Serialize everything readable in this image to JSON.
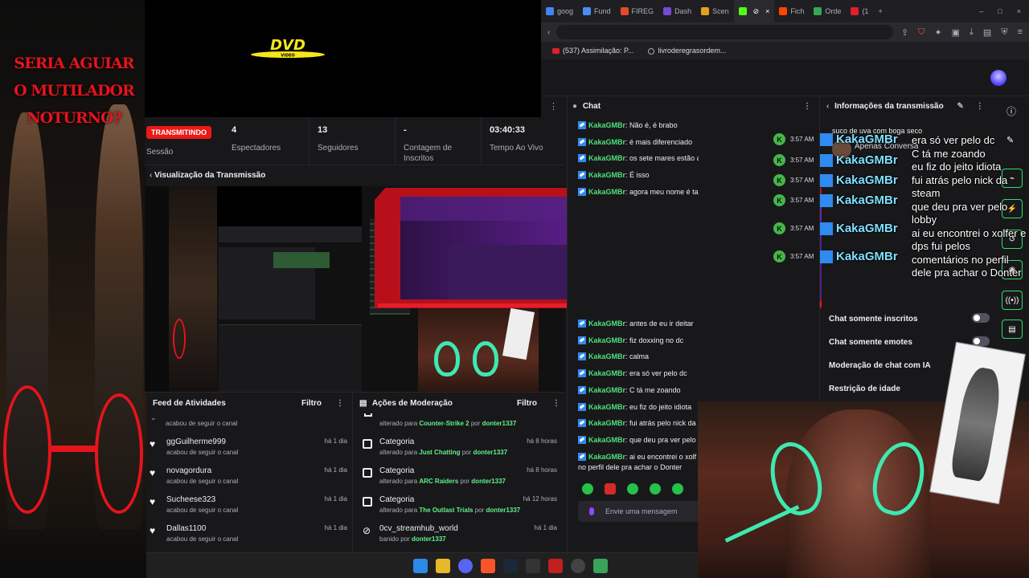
{
  "browser": {
    "tabs": [
      {
        "label": "goog",
        "color": "#4285f4"
      },
      {
        "label": "Fund",
        "color": "#4c8bf5"
      },
      {
        "label": "FIREG",
        "color": "#e24a2a"
      },
      {
        "label": "Dash",
        "color": "#7a4bd0"
      },
      {
        "label": "Scen",
        "color": "#e6a020"
      },
      {
        "label": "",
        "color": "#53fc18"
      },
      {
        "label": "Fich",
        "color": "#ff4500"
      },
      {
        "label": "Orde",
        "color": "#34a853"
      },
      {
        "label": "(1",
        "color": "#e0202a"
      }
    ],
    "new_tab": "+",
    "bookmarks": [
      "(537) Assimilação: P...",
      "livroderegrasordem..."
    ]
  },
  "overlay": {
    "title": "SERIA AGUIAR O MUTILADOR NOTURNO?",
    "dvd_text": "DVD",
    "dvd_sub": "VIDEO"
  },
  "stats": {
    "live_badge": "TRANSMITINDO",
    "session_label": "Sessão",
    "viewers_value": "4",
    "viewers_label": "Espectadores",
    "followers_value": "13",
    "followers_label": "Seguidores",
    "subs_value": "-",
    "subs_label": "Contagem de Inscritos",
    "uptime_value": "03:40:33",
    "uptime_label": "Tempo Ao Vivo"
  },
  "preview": {
    "title": "Visualização da Transmissão"
  },
  "chat": {
    "title": "Chat",
    "messages": [
      {
        "user": "KakaGMBr",
        "text": "Não é, é brabo"
      },
      {
        "user": "KakaGMBr",
        "text": "é mais diferenciado"
      },
      {
        "user": "KakaGMBr",
        "text": "os sete mares estão ai pra isso pô"
      },
      {
        "user": "KakaGMBr",
        "text": "É isso"
      },
      {
        "user": "KakaGMBr",
        "text": "agora meu nome é tachas"
      }
    ],
    "messages_lower": [
      {
        "user": "KakaGMBr",
        "text": "antes de eu ir deitar"
      },
      {
        "user": "KakaGMBr",
        "text": "fiz doxxing no dc"
      },
      {
        "user": "KakaGMBr",
        "text": "calma"
      },
      {
        "user": "KakaGMBr",
        "text": "era só ver pelo dc"
      },
      {
        "user": "KakaGMBr",
        "text": "C tá me zoando"
      },
      {
        "user": "KakaGMBr",
        "text": "eu fiz do jeito idiota"
      },
      {
        "user": "KakaGMBr",
        "text": "fui atrás pelo nick da"
      },
      {
        "user": "KakaGMBr",
        "text": "que deu pra ver pelo"
      },
      {
        "user": "KakaGMBr",
        "text": "ai eu encontrei o xolf"
      }
    ],
    "wrap_line": "no perfil dele pra achar o Donter",
    "input_placeholder": "Envie uma mensagem"
  },
  "times": [
    "3:57 AM",
    "3:57 AM",
    "3:57 AM",
    "3:57 AM",
    "3:57 AM",
    "3:57 AM"
  ],
  "overlay_chat": {
    "names": [
      "KakaGMBr",
      "KakaGMBr",
      "KakaGMBr",
      "KakaGMBr",
      "KakaGMBr",
      "KakaGMBr"
    ],
    "message_lines": [
      "era só ver pelo dc",
      "C tá me zoando",
      "eu fiz do jeito idiota",
      "fui atrás pelo nick da steam",
      "que deu pra ver pelo lobby",
      "ai eu encontrei o xolfer e dps fui pelos comentários no perfil dele pra achar o Donter"
    ]
  },
  "info": {
    "title": "Informações da transmissão",
    "stream_title": "suco de uva com boga seco",
    "mini_chat_text": "Apenas Conversa",
    "toggles": [
      {
        "label": "Chat somente inscritos",
        "on": false
      },
      {
        "label": "Chat somente emotes",
        "on": false
      },
      {
        "label": "Moderação de chat com IA"
      },
      {
        "label": "Restrição de idade"
      }
    ]
  },
  "feed": {
    "title": "Feed de Atividades",
    "filter": "Filtro",
    "first_sub": "acabou de seguir o canal",
    "items": [
      {
        "name": "ggGuilherme999",
        "sub": "acabou de seguir o canal",
        "time": "há 1 dia"
      },
      {
        "name": "novagordura",
        "sub": "acabou de seguir o canal",
        "time": "há 1 dia"
      },
      {
        "name": "Sucheese323",
        "sub": "acabou de seguir o canal",
        "time": "há 1 dia"
      },
      {
        "name": "Dallas1100",
        "sub": "acabou de seguir o canal",
        "time": "há 1 dia"
      }
    ]
  },
  "moderation": {
    "title": "Ações de Moderação",
    "filter": "Filtro",
    "first": {
      "prefix": "alterado para ",
      "game": "Counter-Strike 2",
      "by": " por ",
      "user": "donter1337"
    },
    "items": [
      {
        "name": "Categoria",
        "prefix": "alterado para ",
        "value": "Just Chatting",
        "by": " por ",
        "user": "donter1337",
        "time": "há 8 horas"
      },
      {
        "name": "Categoria",
        "prefix": "alterado para ",
        "value": "ARC Raiders",
        "by": " por ",
        "user": "donter1337",
        "time": "há 8 horas"
      },
      {
        "name": "Categoria",
        "prefix": "alterado para ",
        "value": "The Outlast Trials",
        "by": " por ",
        "user": "donter1337",
        "time": "há 12 horas"
      },
      {
        "name": "0cv_streamhub_world",
        "prefix": "banido por ",
        "value": "",
        "by": "",
        "user": "donter1337",
        "time": "há 1 dia"
      }
    ]
  },
  "colors": {
    "accent_green": "#53fc18",
    "live_red": "#e91916",
    "overlay_red": "#e4141c",
    "link_green": "#5ff28a"
  }
}
